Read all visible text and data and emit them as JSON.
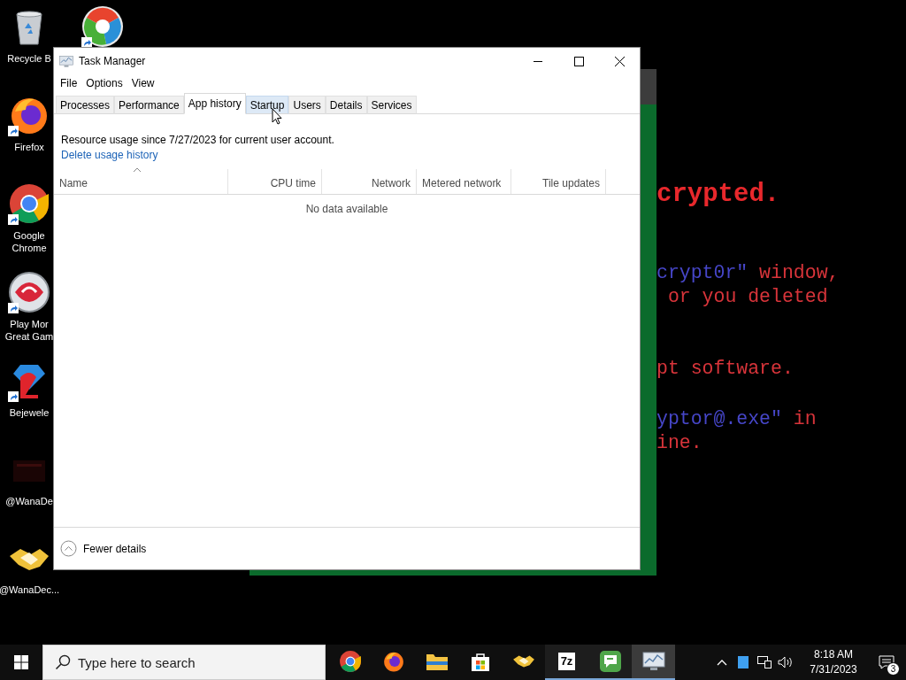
{
  "desktop": {
    "icons": [
      {
        "kind": "recycle-bin",
        "label": [
          "Recycle B"
        ],
        "shortcut": false
      },
      {
        "kind": "firefox",
        "label": [
          "Firefox"
        ],
        "shortcut": true
      },
      {
        "kind": "chrome",
        "label": [
          "Google",
          "Chrome"
        ],
        "shortcut": true
      },
      {
        "kind": "popcap",
        "label": [
          "Play Mor",
          "Great Gam"
        ],
        "shortcut": true
      },
      {
        "kind": "gem",
        "label": [
          "Bejewele"
        ],
        "shortcut": true
      },
      {
        "kind": "dark",
        "label": [
          "@WanaDe"
        ],
        "shortcut": false
      },
      {
        "kind": "handshake",
        "label": [
          "@WanaDec..."
        ],
        "shortcut": false
      }
    ],
    "second_column_icon": {
      "kind": "color-wheel",
      "shortcut": true
    }
  },
  "background_window": {
    "paragraphs": [
      {
        "kind": "heading",
        "lines": [
          [
            {
              "text": "crypted.",
              "color": "#e8282c"
            }
          ]
        ]
      },
      {
        "kind": "body",
        "lines": [
          [
            {
              "text": "crypt0r\"",
              "color": "#4646c8"
            },
            {
              "text": " window,",
              "color": "#d8343a"
            }
          ],
          [
            {
              "text": " or you deleted",
              "color": "#d8343a"
            }
          ]
        ]
      },
      {
        "kind": "body",
        "lines": [
          [
            {
              "text": "pt software.",
              "color": "#d8343a"
            }
          ]
        ]
      },
      {
        "kind": "body",
        "lines": [
          [
            {
              "text": "yptor@.exe\"",
              "color": "#4646c8"
            },
            {
              "text": " in",
              "color": "#d8343a"
            }
          ],
          [
            {
              "text": "ine.",
              "color": "#d8343a"
            }
          ]
        ]
      }
    ]
  },
  "task_manager": {
    "title": "Task Manager",
    "menu": [
      "File",
      "Options",
      "View"
    ],
    "tabs": [
      {
        "label": "Processes",
        "selected": false,
        "hovered": false
      },
      {
        "label": "Performance",
        "selected": false,
        "hovered": false
      },
      {
        "label": "App history",
        "selected": true,
        "hovered": false
      },
      {
        "label": "Startup",
        "selected": false,
        "hovered": true
      },
      {
        "label": "Users",
        "selected": false,
        "hovered": false
      },
      {
        "label": "Details",
        "selected": false,
        "hovered": false
      },
      {
        "label": "Services",
        "selected": false,
        "hovered": false
      }
    ],
    "summary": "Resource usage since 7/27/2023 for current user account.",
    "delete_link": "Delete usage history",
    "columns": [
      {
        "label": "Name",
        "sorted": true
      },
      {
        "label": "CPU time",
        "sorted": false
      },
      {
        "label": "Network",
        "sorted": false
      },
      {
        "label": "Metered network",
        "sorted": false
      },
      {
        "label": "Tile updates",
        "sorted": false
      }
    ],
    "empty_message": "No data available",
    "footer_button": "Fewer details"
  },
  "taskbar": {
    "search": {
      "placeholder": "Type here to search"
    },
    "apps": [
      {
        "kind": "chrome",
        "running": false,
        "active": false
      },
      {
        "kind": "firefox",
        "running": false,
        "active": false
      },
      {
        "kind": "folder",
        "running": false,
        "active": false
      },
      {
        "kind": "store",
        "running": false,
        "active": false
      },
      {
        "kind": "handshake",
        "running": false,
        "active": false
      },
      {
        "kind": "archive",
        "label": "7z",
        "running": true,
        "active": false
      },
      {
        "kind": "chat",
        "running": true,
        "active": false
      },
      {
        "kind": "taskmgr",
        "running": true,
        "active": true
      }
    ],
    "time": "8:18 AM",
    "date": "7/31/2023",
    "notification_count": "3"
  }
}
